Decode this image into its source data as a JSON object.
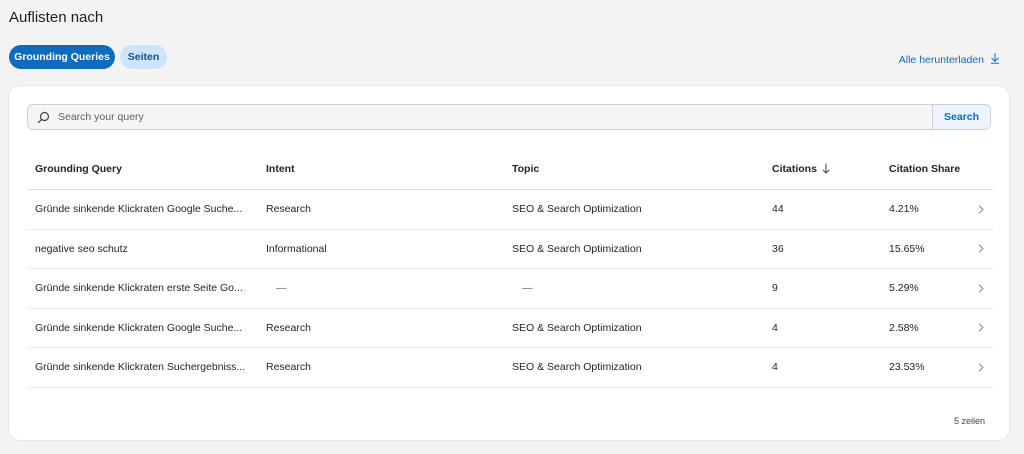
{
  "header": {
    "title": "Auflisten nach"
  },
  "tabs": [
    {
      "label": "Grounding Queries",
      "active": true
    },
    {
      "label": "Seiten",
      "active": false
    }
  ],
  "download": {
    "label": "Alle herunterladen",
    "icon": "download-arrow-icon"
  },
  "search": {
    "placeholder": "Search your query",
    "value": "",
    "button_label": "Search",
    "icon": "search-icon"
  },
  "table": {
    "columns": [
      "Grounding Query",
      "Intent",
      "Topic",
      "Citations",
      "Citation Share"
    ],
    "sort": {
      "column": "Citations",
      "direction": "descending",
      "icon": "arrow-down-icon"
    },
    "rows": [
      {
        "query": "Gründe sinkende Klickraten Google Suche...",
        "intent": "Research",
        "topic": "SEO & Search Optimization",
        "citations": "44",
        "share": "4.21%"
      },
      {
        "query": "negative seo schutz",
        "intent": "Informational",
        "topic": "SEO & Search Optimization",
        "citations": "36",
        "share": "15.65%"
      },
      {
        "query": "Gründe sinkende Klickraten erste Seite Go...",
        "intent": "—",
        "topic": "—",
        "citations": "9",
        "share": "5.29%"
      },
      {
        "query": "Gründe sinkende Klickraten Google Suche...",
        "intent": "Research",
        "topic": "SEO & Search Optimization",
        "citations": "4",
        "share": "2.58%"
      },
      {
        "query": "Gründe sinkende Klickraten Suchergebniss...",
        "intent": "Research",
        "topic": "SEO & Search Optimization",
        "citations": "4",
        "share": "23.53%"
      }
    ],
    "row_count": "5 zeilen"
  },
  "colors": {
    "accent": "#0f6cbd",
    "inactive_tab_bg": "#cfe4fa",
    "page_bg": "#f3f3f3",
    "card_bg": "#ffffff"
  }
}
